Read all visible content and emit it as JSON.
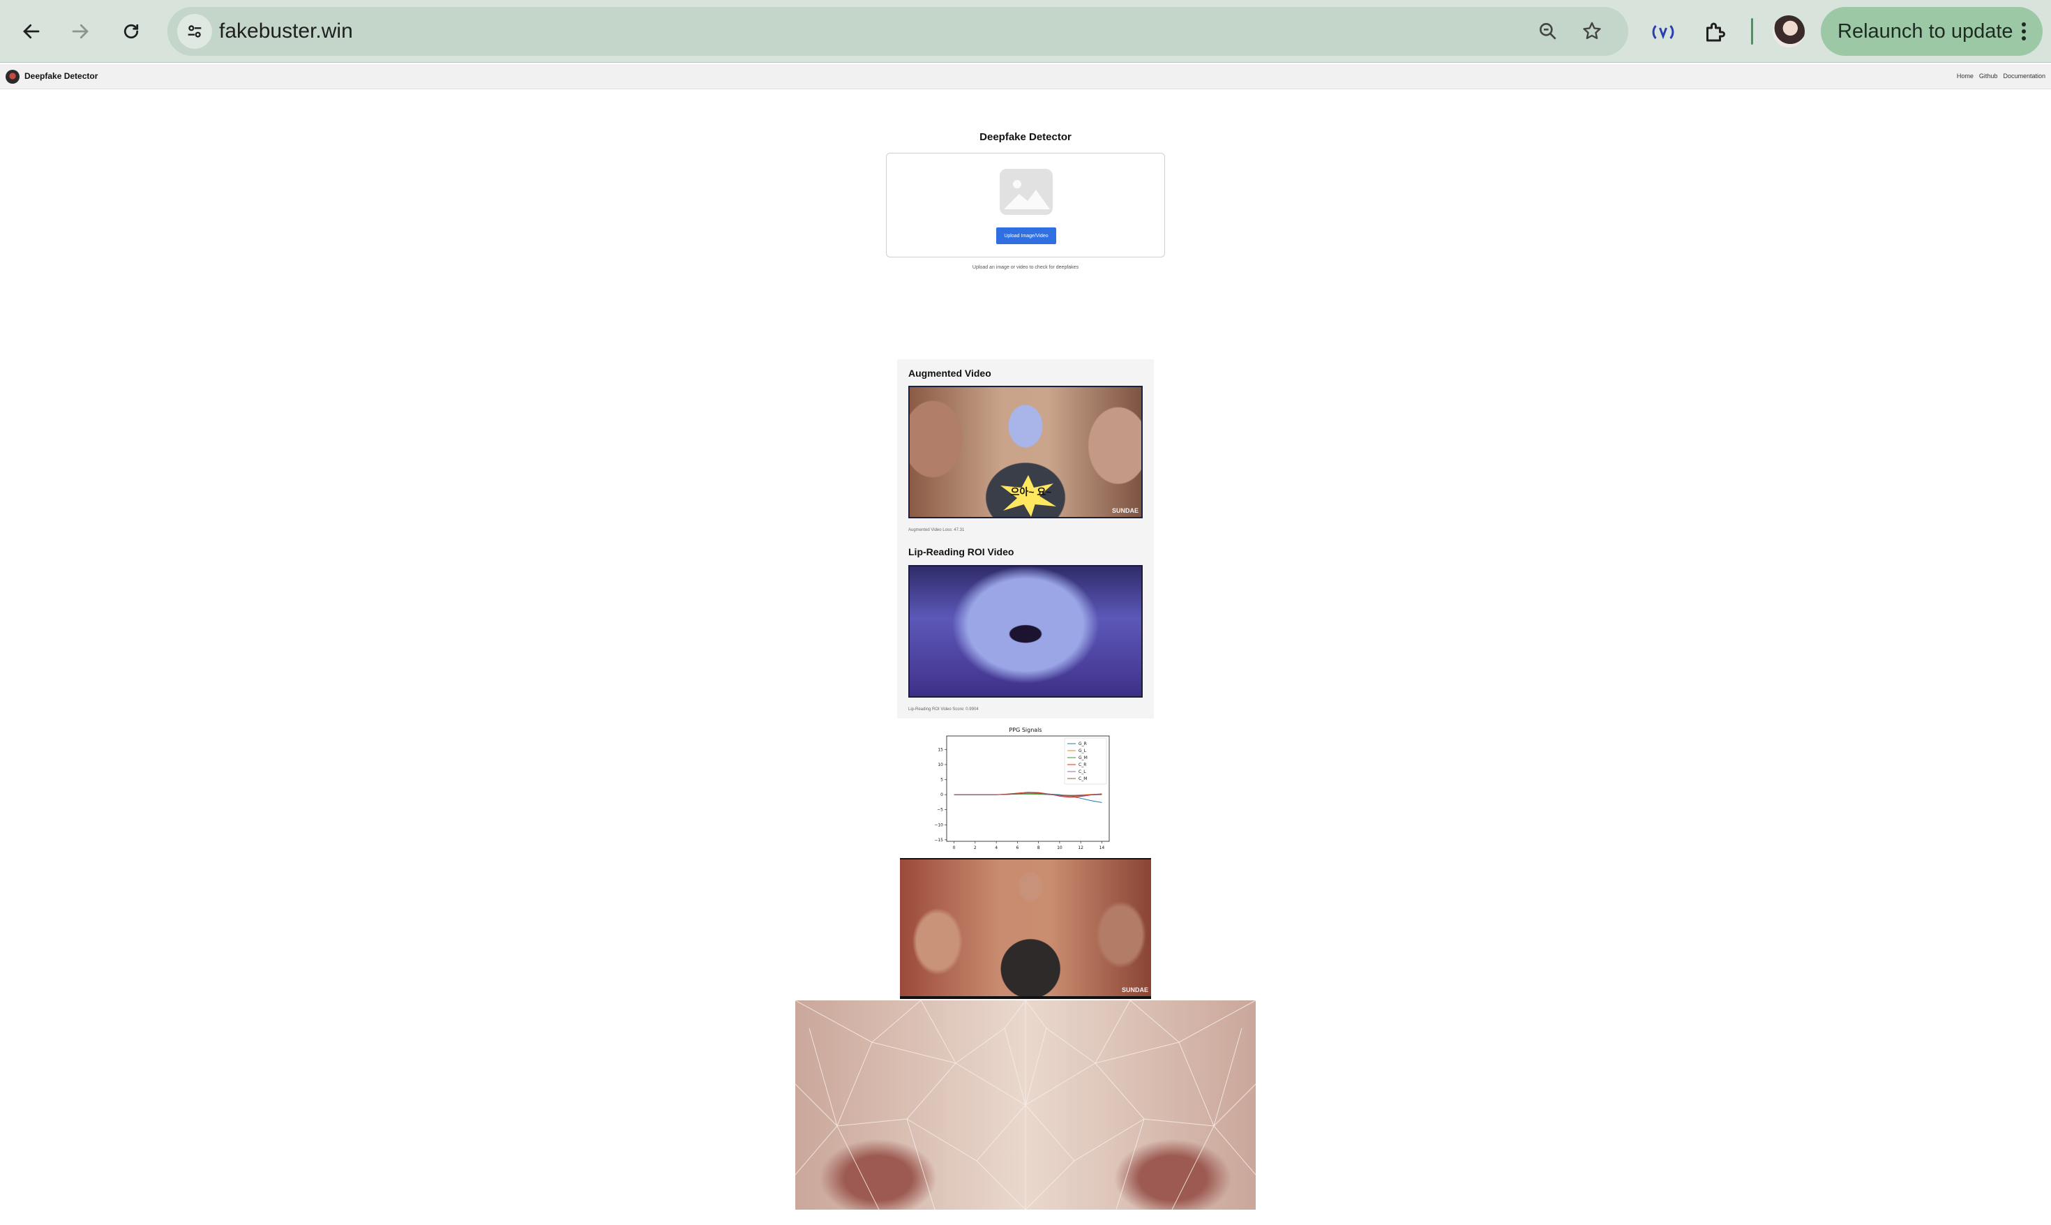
{
  "browser": {
    "url": "fakebuster.win",
    "relaunch_label": "Relaunch to update"
  },
  "site": {
    "title": "Deepfake Detector",
    "nav": [
      "Home",
      "Github",
      "Documentation"
    ]
  },
  "upload": {
    "heading": "Deepfake Detector",
    "button_label": "Upload Image/Video",
    "hint": "Upload an image or video to check for deepfakes"
  },
  "results": {
    "augmented_title": "Augmented Video",
    "augmented_overlay_text": "으아~ 요~",
    "augmented_watermark": "SUNDAE",
    "augmented_caption": "Augmented Video Loss: 47.31",
    "lip_title": "Lip-Reading ROI Video",
    "lip_caption": "Lip-Reading ROI Video Score: 0.9904"
  },
  "original_watermark": "SUNDAE",
  "colors": {
    "chrome_bg": "#d7e3db",
    "relaunch_bg": "#9cc8a6",
    "upload_button": "#2f6fe2"
  },
  "chart_data": {
    "type": "line",
    "title": "PPG Signals",
    "x": [
      0,
      1,
      2,
      3,
      4,
      5,
      6,
      7,
      8,
      9,
      10,
      11,
      12,
      13,
      14
    ],
    "xlim": [
      -0.7,
      14.7
    ],
    "ylim": [
      -15.5,
      19.5
    ],
    "xticks": [
      0,
      2,
      4,
      6,
      8,
      10,
      12,
      14
    ],
    "yticks": [
      15,
      10,
      5,
      0,
      -5,
      -10,
      -15
    ],
    "ytick_labels": [
      "15",
      "10",
      "5",
      "0",
      "−5",
      "−10",
      "−15"
    ],
    "legend_position": "top-right",
    "series": [
      {
        "name": "G_R",
        "color": "#1f77b4",
        "values": [
          0,
          0,
          0,
          0,
          0,
          0.1,
          0.2,
          0.3,
          0.3,
          0.2,
          0,
          -0.5,
          -1.2,
          -2.0,
          -2.6
        ]
      },
      {
        "name": "G_L",
        "color": "#ff7f0e",
        "values": [
          0,
          0,
          0,
          0,
          0,
          0.1,
          0.2,
          0.3,
          0.2,
          0,
          -0.2,
          -0.3,
          -0.1,
          0.1,
          0.2
        ]
      },
      {
        "name": "G_M",
        "color": "#2ca02c",
        "values": [
          0,
          0,
          0,
          0,
          0,
          0.1,
          0.2,
          0.2,
          0.2,
          0,
          -0.1,
          -0.2,
          -0.2,
          -0.1,
          0
        ]
      },
      {
        "name": "C_R",
        "color": "#d62728",
        "values": [
          0,
          0,
          0,
          0,
          0,
          0.2,
          0.5,
          0.8,
          0.7,
          0.2,
          -0.5,
          -0.9,
          -0.6,
          -0.1,
          0.2
        ]
      },
      {
        "name": "C_L",
        "color": "#9467bd",
        "values": [
          0,
          0,
          0,
          0,
          0,
          0.1,
          0.3,
          0.5,
          0.4,
          0.1,
          -0.3,
          -0.6,
          -0.4,
          0,
          0.3
        ]
      },
      {
        "name": "C_M",
        "color": "#8c564b",
        "values": [
          0,
          0,
          0,
          0,
          0,
          0.1,
          0.3,
          0.5,
          0.5,
          0.2,
          -0.2,
          -0.4,
          -0.3,
          0,
          0.2
        ]
      }
    ]
  }
}
